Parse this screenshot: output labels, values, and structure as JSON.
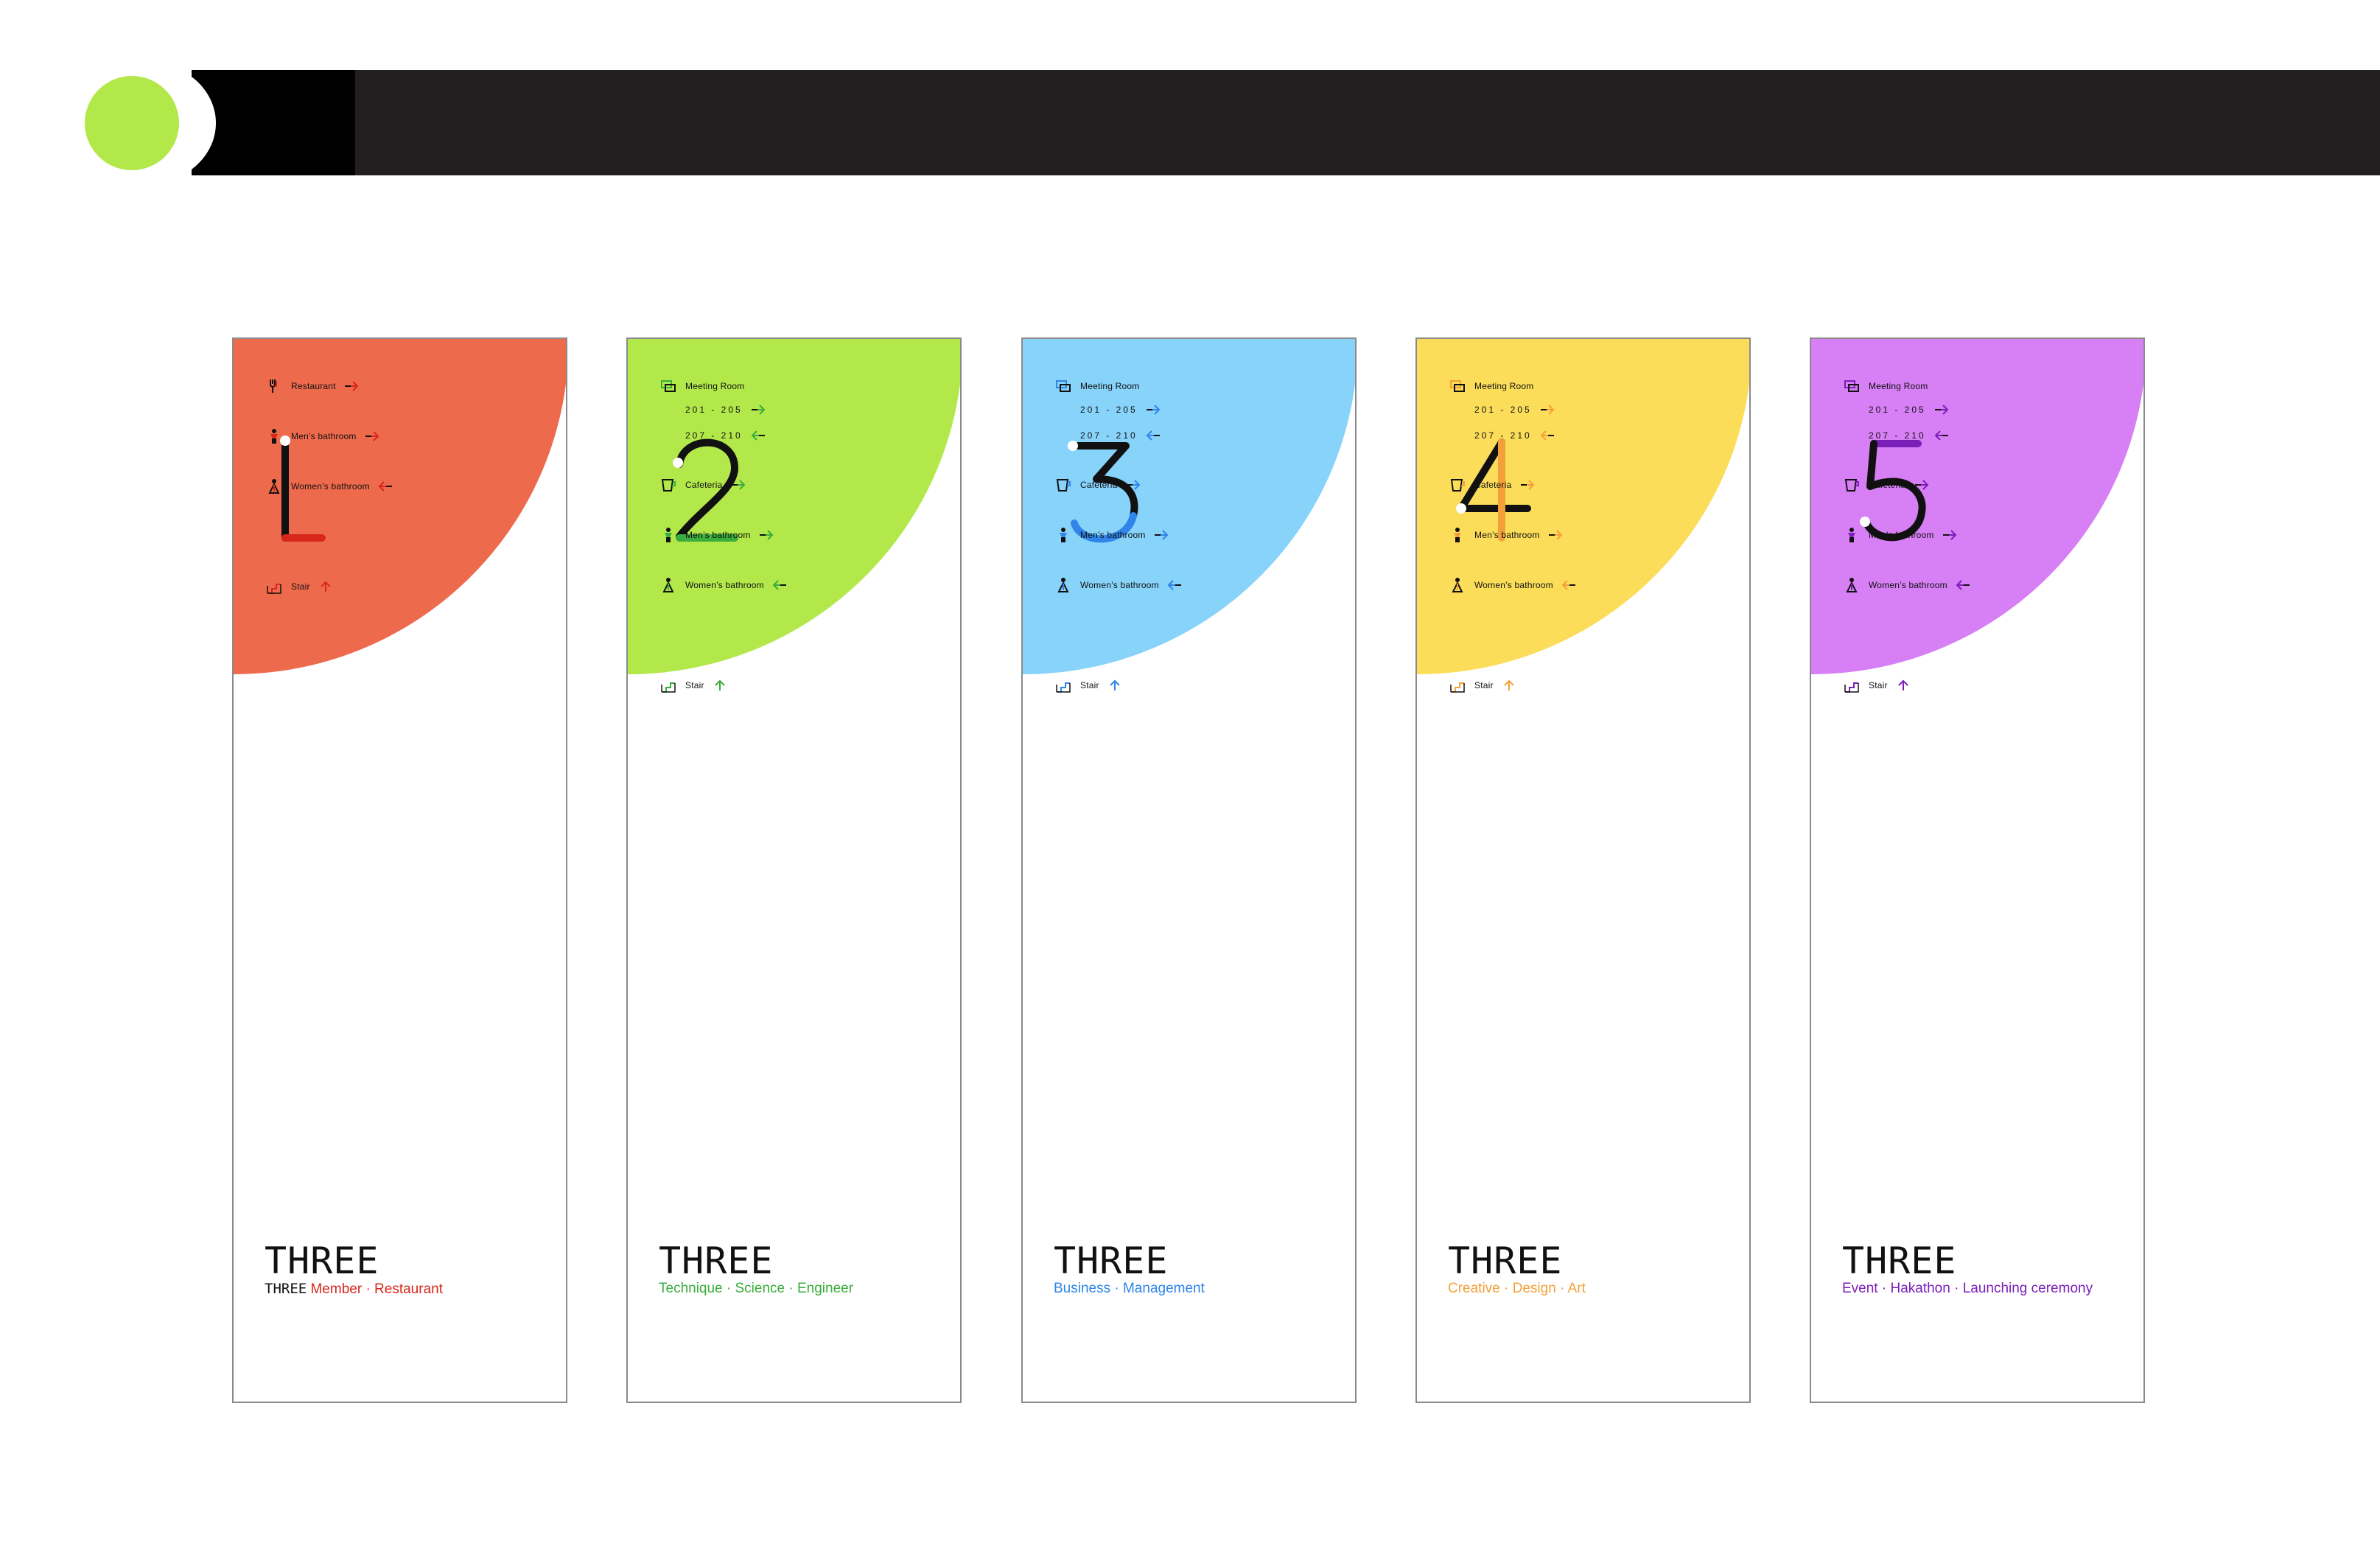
{
  "header": {
    "accent_color": "#b3e84a",
    "bar_color": "#231f20"
  },
  "panels": [
    {
      "numeral": "1",
      "color": "#ee6a4d",
      "accent": "#d7261b",
      "brand": "THREE",
      "tagline_prefix": "THREE",
      "tagline": "Member · Restaurant",
      "rows": [
        {
          "type": "item",
          "icon": "restaurant-icon",
          "label": "Restaurant",
          "arrow": "right"
        },
        {
          "type": "item",
          "icon": "mens-bathroom-icon",
          "label": "Men’s bathroom",
          "arrow": "right"
        },
        {
          "type": "item",
          "icon": "womens-bathroom-icon",
          "label": "Women’s bathroom",
          "arrow": "left"
        },
        {
          "type": "gap"
        },
        {
          "type": "item",
          "icon": "stair-icon",
          "label": "Stair",
          "arrow": "up"
        }
      ]
    },
    {
      "numeral": "2",
      "color": "#b3e84a",
      "accent": "#3aad3c",
      "brand": "THREE",
      "tagline_prefix": "",
      "tagline": "Technique · Science · Engineer",
      "rows": [
        {
          "type": "item",
          "icon": "meeting-room-icon",
          "label": "Meeting Room",
          "arrow": ""
        },
        {
          "type": "range",
          "label": "201 - 205",
          "arrow": "right"
        },
        {
          "type": "range",
          "label": "207 - 210",
          "arrow": "left"
        },
        {
          "type": "item",
          "icon": "cafeteria-icon",
          "label": "Cafeteria",
          "arrow": "right"
        },
        {
          "type": "item",
          "icon": "mens-bathroom-icon",
          "label": "Men’s bathroom",
          "arrow": "right"
        },
        {
          "type": "item",
          "icon": "womens-bathroom-icon",
          "label": "Women’s bathroom",
          "arrow": "left"
        },
        {
          "type": "gap"
        },
        {
          "type": "item",
          "icon": "stair-icon",
          "label": "Stair",
          "arrow": "up"
        }
      ]
    },
    {
      "numeral": "3",
      "color": "#87d3fa",
      "accent": "#2f85e8",
      "brand": "THREE",
      "tagline_prefix": "",
      "tagline": "Business · Management",
      "rows": [
        {
          "type": "item",
          "icon": "meeting-room-icon",
          "label": "Meeting Room",
          "arrow": ""
        },
        {
          "type": "range",
          "label": "201 - 205",
          "arrow": "right"
        },
        {
          "type": "range",
          "label": "207 - 210",
          "arrow": "left"
        },
        {
          "type": "item",
          "icon": "cafeteria-icon",
          "label": "Cafeteria",
          "arrow": "right"
        },
        {
          "type": "item",
          "icon": "mens-bathroom-icon",
          "label": "Men’s bathroom",
          "arrow": "right"
        },
        {
          "type": "item",
          "icon": "womens-bathroom-icon",
          "label": "Women’s bathroom",
          "arrow": "left"
        },
        {
          "type": "gap"
        },
        {
          "type": "item",
          "icon": "stair-icon",
          "label": "Stair",
          "arrow": "up"
        }
      ]
    },
    {
      "numeral": "4",
      "color": "#fbdd5a",
      "accent": "#f3a03a",
      "brand": "THREE",
      "tagline_prefix": "",
      "tagline": "Creative · Design · Art",
      "rows": [
        {
          "type": "item",
          "icon": "meeting-room-icon",
          "label": "Meeting Room",
          "arrow": ""
        },
        {
          "type": "range",
          "label": "201 - 205",
          "arrow": "right"
        },
        {
          "type": "range",
          "label": "207 - 210",
          "arrow": "left"
        },
        {
          "type": "item",
          "icon": "cafeteria-icon",
          "label": "Cafeteria",
          "arrow": "right"
        },
        {
          "type": "item",
          "icon": "mens-bathroom-icon",
          "label": "Men’s bathroom",
          "arrow": "right"
        },
        {
          "type": "item",
          "icon": "womens-bathroom-icon",
          "label": "Women’s bathroom",
          "arrow": "left"
        },
        {
          "type": "gap"
        },
        {
          "type": "item",
          "icon": "stair-icon",
          "label": "Stair",
          "arrow": "up"
        }
      ]
    },
    {
      "numeral": "5",
      "color": "#d77ff5",
      "accent": "#7a1fb8",
      "brand": "THREE",
      "tagline_prefix": "",
      "tagline": "Event · Hakathon · Launching ceremony",
      "rows": [
        {
          "type": "item",
          "icon": "meeting-room-icon",
          "label": "Meeting Room",
          "arrow": ""
        },
        {
          "type": "range",
          "label": "201 - 205",
          "arrow": "right"
        },
        {
          "type": "range",
          "label": "207 - 210",
          "arrow": "left"
        },
        {
          "type": "item",
          "icon": "cafeteria-icon",
          "label": "Cafeteria",
          "arrow": "right"
        },
        {
          "type": "item",
          "icon": "mens-bathroom-icon",
          "label": "Men’s bathroom",
          "arrow": "right"
        },
        {
          "type": "item",
          "icon": "womens-bathroom-icon",
          "label": "Women’s bathroom",
          "arrow": "left"
        },
        {
          "type": "gap"
        },
        {
          "type": "item",
          "icon": "stair-icon",
          "label": "Stair",
          "arrow": "up"
        }
      ]
    }
  ]
}
